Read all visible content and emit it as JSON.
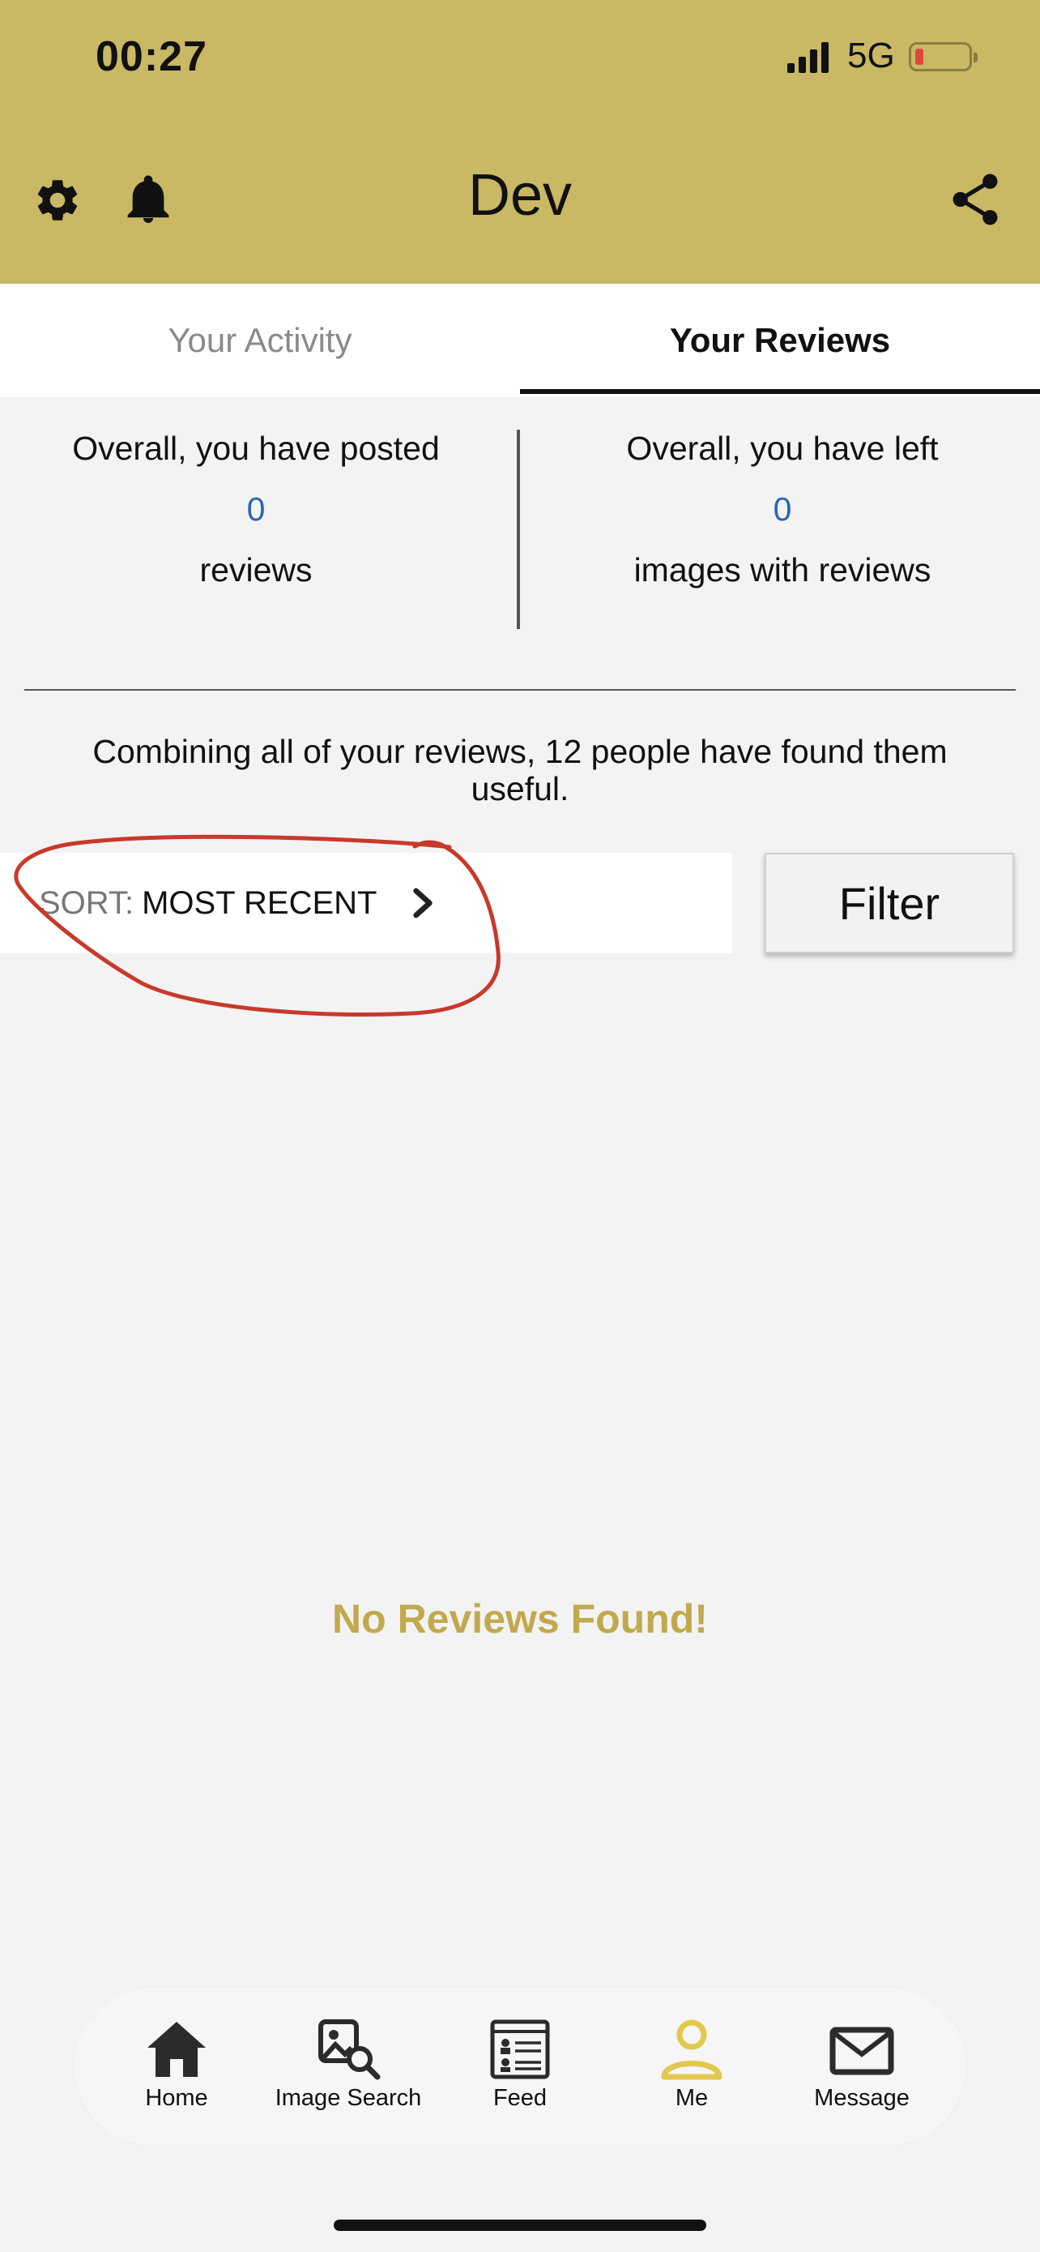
{
  "status_bar": {
    "time": "00:27",
    "network": "5G",
    "battery_color": "#e2463a"
  },
  "header": {
    "title": "Dev",
    "background": "#c9b864",
    "icons": [
      "gear-icon",
      "bell-icon",
      "share-icon"
    ]
  },
  "tabs": [
    {
      "label": "Your Activity",
      "active": false
    },
    {
      "label": "Your Reviews",
      "active": true
    }
  ],
  "stats": {
    "posted": {
      "prefix": "Overall, you have posted",
      "value": "0",
      "suffix": "reviews"
    },
    "images": {
      "prefix": "Overall, you have left",
      "value": "0",
      "suffix": "images with reviews"
    }
  },
  "combined_text": "Combining all of your reviews, 12 people have found them useful.",
  "sort": {
    "label": "SORT:",
    "value": "MOST RECENT"
  },
  "filter_label": "Filter",
  "empty_message": "No Reviews Found!",
  "bottom_nav": [
    {
      "label": "Home",
      "icon": "home-icon",
      "active": false
    },
    {
      "label": "Image Search",
      "icon": "image-search-icon",
      "active": false
    },
    {
      "label": "Feed",
      "icon": "feed-icon",
      "active": false
    },
    {
      "label": "Me",
      "icon": "person-icon",
      "active": true
    },
    {
      "label": "Message",
      "icon": "envelope-icon",
      "active": false
    }
  ],
  "colors": {
    "accent": "#c9b864",
    "empty_text": "#c2a94f",
    "count": "#2a65b3",
    "annotation": "#c8392b"
  }
}
